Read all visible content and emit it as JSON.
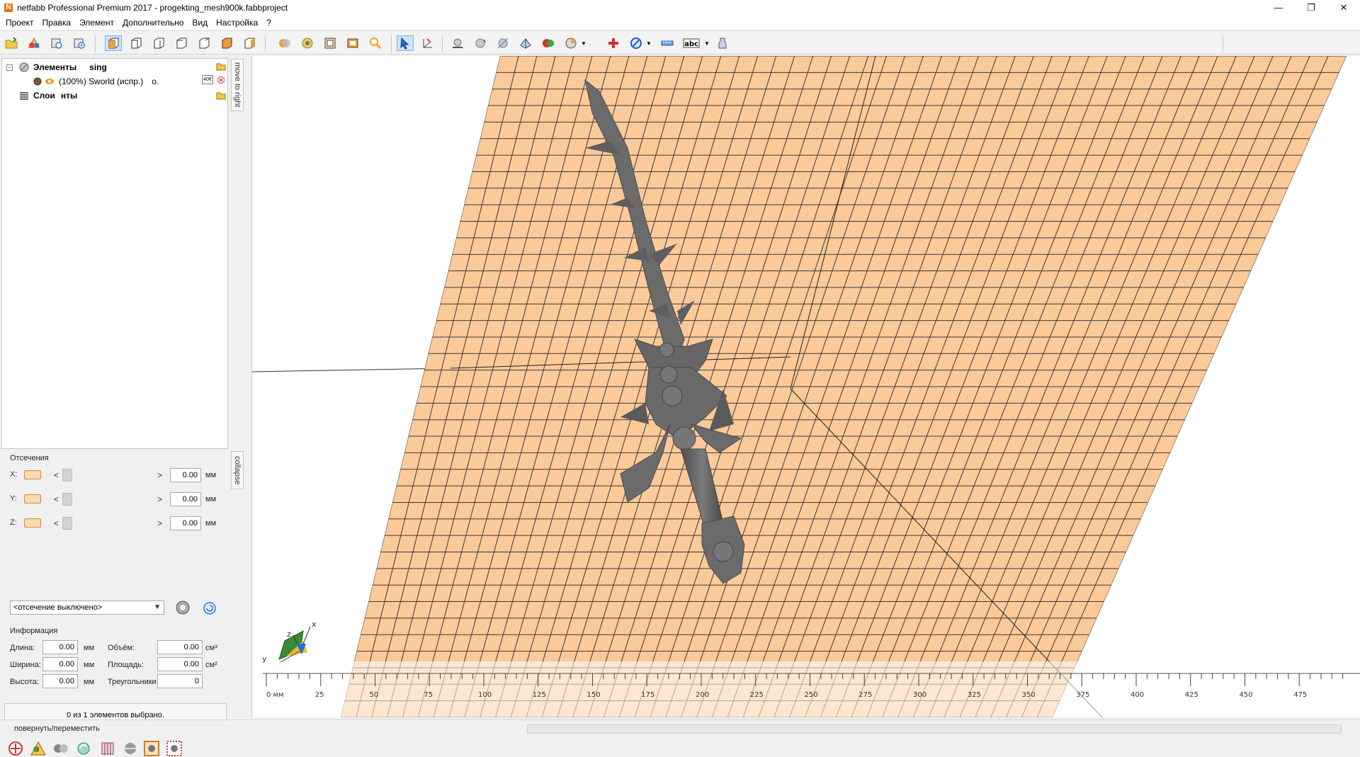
{
  "window": {
    "title": "netfabb Professional Premium 2017 - progekting_mesh900k.fabbproject",
    "app_icon_letter": "N",
    "minimize": "—",
    "restore": "❐",
    "close": "✕"
  },
  "menu": [
    "Проект",
    "Правка",
    "Элемент",
    "Дополнительно",
    "Вид",
    "Настройка",
    "?"
  ],
  "tree": {
    "elements_label": "Элементы",
    "elements_suffix": "sing",
    "item_label": "(100%) Sworld (испр.)",
    "item_suffix": "о.",
    "item_badge": "40€",
    "layers_label": "Слои",
    "layers_suffix": "нты",
    "expander": "−"
  },
  "tabs": {
    "move_to_right": "move to right",
    "collapse": "collapse"
  },
  "cuts": {
    "title": "Отсечения",
    "rows": [
      {
        "axis": "X:",
        "value": "0.00",
        "unit": "мм"
      },
      {
        "axis": "Y:",
        "value": "0.00",
        "unit": "мм"
      },
      {
        "axis": "Z:",
        "value": "0.00",
        "unit": "мм"
      }
    ],
    "left_arrow": "<",
    "right_arrow": ">",
    "mode": "<отсечение выключено>"
  },
  "info": {
    "title": "Информация",
    "length_label": "Длина:",
    "length_value": "0.00",
    "length_unit": "мм",
    "width_label": "Ширина:",
    "width_value": "0.00",
    "width_unit": "мм",
    "height_label": "Высота:",
    "height_value": "0.00",
    "height_unit": "мм",
    "volume_label": "Объём:",
    "volume_value": "0.00",
    "volume_unit": "см³",
    "area_label": "Площадь:",
    "area_value": "0.00",
    "area_unit": "см²",
    "triangles_label": "Треугольники",
    "triangles_value": "0"
  },
  "selection_status": "0 из 1 элементов выбрано.",
  "axes": {
    "x": "x",
    "y": "y",
    "z": "z"
  },
  "ruler": {
    "labels": [
      "0 мм",
      "25",
      "50",
      "75",
      "100",
      "125",
      "150",
      "175",
      "200",
      "225",
      "250",
      "275",
      "300",
      "325",
      "350",
      "375",
      "400",
      "425",
      "450",
      "475"
    ]
  },
  "status": "повернуть/переместить",
  "colors": {
    "platform": "#fcc999",
    "grid": "#3a3a3a",
    "model": "#6b6b6b",
    "accent": "#e07a10"
  }
}
